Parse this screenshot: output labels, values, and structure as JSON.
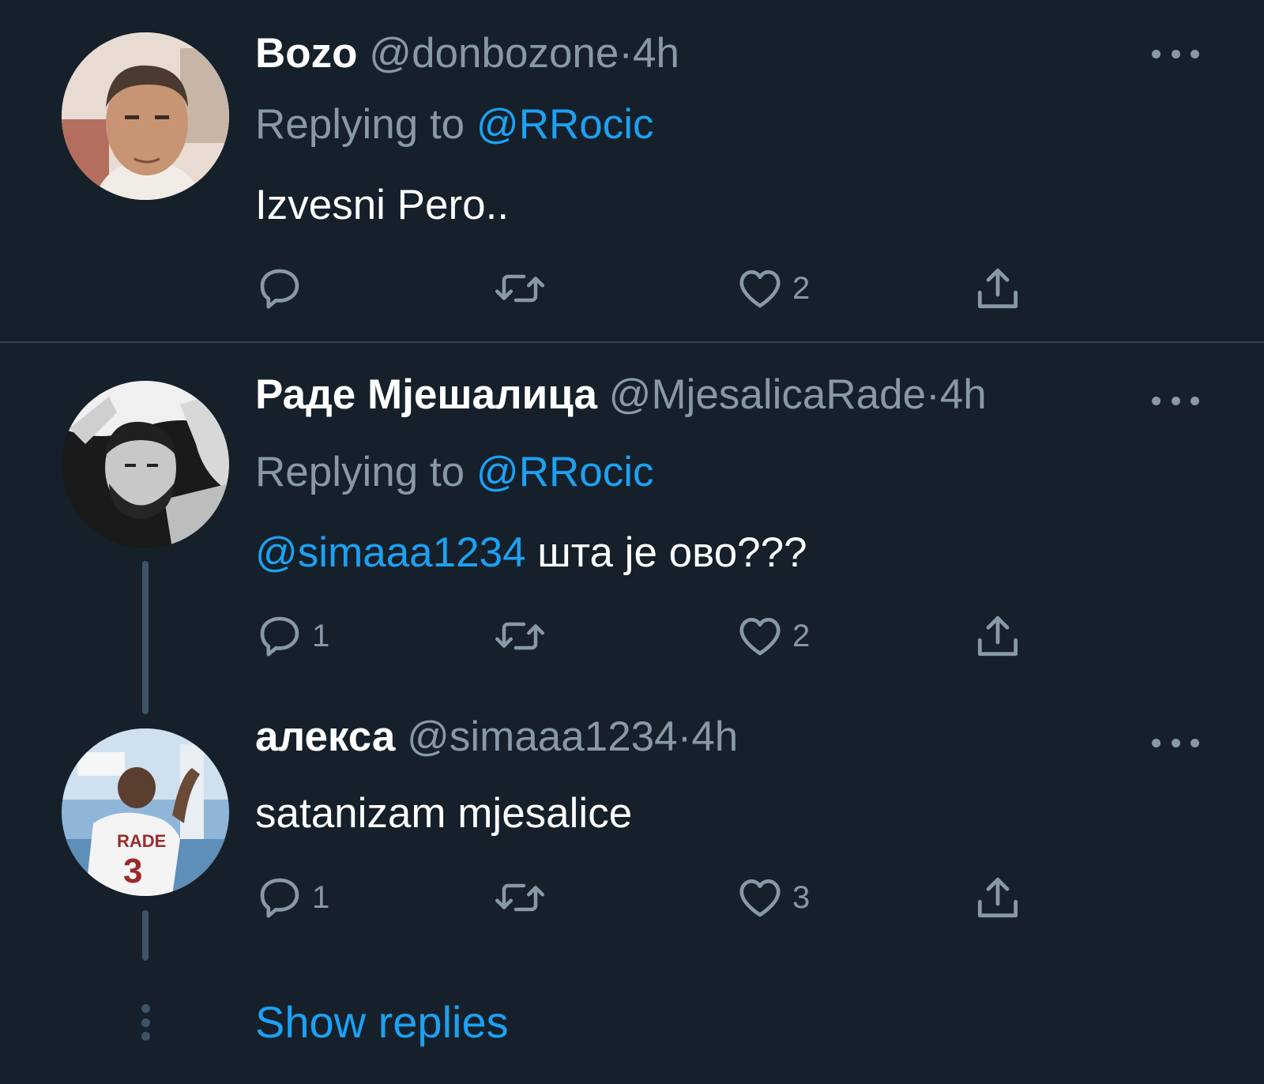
{
  "tweets": [
    {
      "display_name": "Bozo",
      "handle": "@donbozone",
      "separator": "·",
      "time": "4h",
      "replying_prefix": "Replying to",
      "replying_handle": "@RRocic",
      "mention": "",
      "text": "Izvesni Pero..",
      "reply_count": "",
      "retweet_count": "",
      "like_count": "2"
    },
    {
      "display_name": "Раде Мјешалица",
      "handle": "@MjesalicaRade",
      "separator": "·",
      "time": "4h",
      "replying_prefix": "Replying to",
      "replying_handle": "@RRocic",
      "mention": "@simaaa1234",
      "text": " шта је ово???",
      "reply_count": "1",
      "retweet_count": "",
      "like_count": "2"
    },
    {
      "display_name": "алекса",
      "handle": "@simaaa1234",
      "separator": "·",
      "time": "4h",
      "mention": "",
      "text": "satanizam mjesalice",
      "reply_count": "1",
      "retweet_count": "",
      "like_count": "3"
    }
  ],
  "show_replies_label": "Show replies",
  "icons": {
    "reply": "reply-icon",
    "retweet": "retweet-icon",
    "like": "heart-icon",
    "share": "share-icon",
    "more": "more-icon"
  },
  "colors": {
    "background": "#15202b",
    "text": "#ffffff",
    "muted": "#8899a6",
    "accent": "#1da1f2",
    "divider": "#38444d"
  }
}
